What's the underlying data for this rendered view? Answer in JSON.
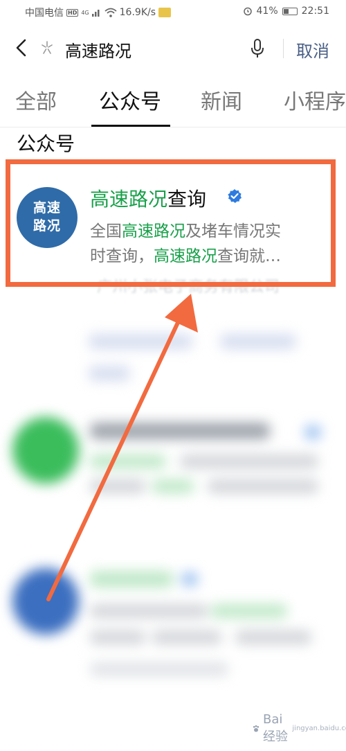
{
  "status_bar": {
    "carrier": "中国电信",
    "hd": "HD",
    "network": "4G",
    "speed": "16.9K/s",
    "battery": "41%",
    "battery_level": 0.41,
    "time": "22:51"
  },
  "search": {
    "query": "高速路况",
    "cancel_label": "取消"
  },
  "tabs": [
    {
      "label": "全部",
      "active": false
    },
    {
      "label": "公众号",
      "active": true
    },
    {
      "label": "新闻",
      "active": false
    },
    {
      "label": "小程序",
      "active": false
    }
  ],
  "section_title": "公众号",
  "result": {
    "avatar_text_line1": "高速",
    "avatar_text_line2": "路况",
    "title_highlight": "高速路况",
    "title_rest": "查询",
    "desc_line1_pre": "全国",
    "desc_line1_hl": "高速路况",
    "desc_line1_post": "及堵车情况实",
    "desc_line2_pre": "时查询，",
    "desc_line2_hl": "高速路况",
    "desc_line2_post": "查询就…",
    "company": "广州小张电子商务有限公司"
  },
  "colors": {
    "accent_green": "#18a04a",
    "highlight_orange": "#f26a3f",
    "cancel_blue": "#4a5f86",
    "avatar_blue": "#2f6ba8",
    "verified_blue": "#2d7be0"
  },
  "watermark": {
    "text": "Bai 经验",
    "sub": "jingyan.baidu.com"
  }
}
